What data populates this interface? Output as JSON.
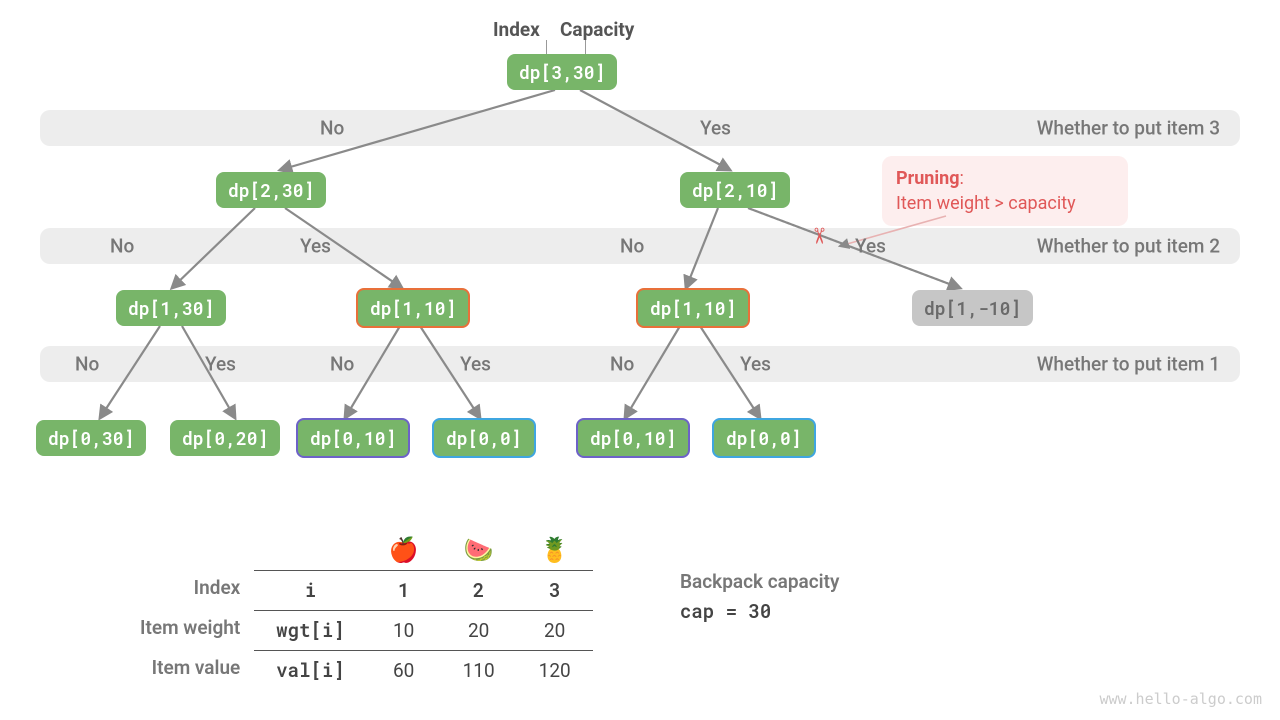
{
  "header": {
    "index": "Index",
    "capacity": "Capacity"
  },
  "bands": [
    {
      "label": "Whether to put item 3"
    },
    {
      "label": "Whether to put item 2"
    },
    {
      "label": "Whether to put item 1"
    }
  ],
  "branch": {
    "no": "No",
    "yes": "Yes"
  },
  "nodes": {
    "root": "dp[3,30]",
    "l2a": "dp[2,30]",
    "l2b": "dp[2,10]",
    "l3a": "dp[1,30]",
    "l3b": "dp[1,10]",
    "l3c": "dp[1,10]",
    "l3d": "dp[1,-10]",
    "l4a": "dp[0,30]",
    "l4b": "dp[0,20]",
    "l4c": "dp[0,10]",
    "l4d": "dp[0,0]",
    "l4e": "dp[0,10]",
    "l4f": "dp[0,0]"
  },
  "pruning": {
    "title": "Pruning",
    "sep": ":",
    "text": "Item weight > capacity"
  },
  "table": {
    "row_headers": [
      "Index",
      "Item weight",
      "Item value"
    ],
    "icons": [
      "apple",
      "watermelon",
      "pineapple"
    ],
    "col0": [
      "i",
      "wgt[i]",
      "val[i]"
    ],
    "rows": [
      [
        "1",
        "2",
        "3"
      ],
      [
        "10",
        "20",
        "20"
      ],
      [
        "60",
        "110",
        "120"
      ]
    ]
  },
  "capacity": {
    "header": "Backpack capacity",
    "value": "cap = 30"
  },
  "footer": "www.hello-algo.com"
}
